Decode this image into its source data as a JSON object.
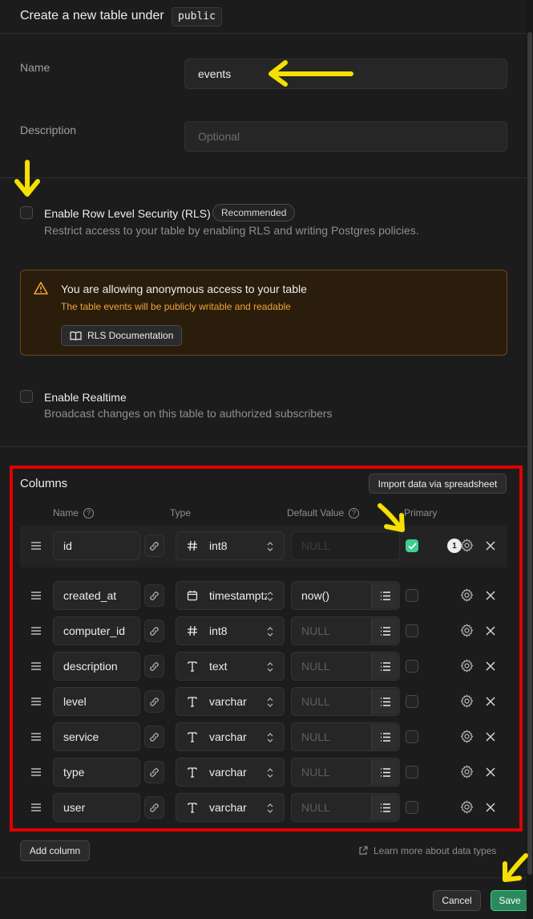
{
  "header": {
    "title": "Create a new table under",
    "schema": "public"
  },
  "form": {
    "name_label": "Name",
    "name_value": "events",
    "description_label": "Description",
    "description_placeholder": "Optional"
  },
  "rls": {
    "title": "Enable Row Level Security (RLS)",
    "badge": "Recommended",
    "subtitle": "Restrict access to your table by enabling RLS and writing Postgres policies.",
    "checked": false
  },
  "warning": {
    "title": "You are allowing anonymous access to your table",
    "subtitle": "The table events will be publicly writable and readable",
    "button": "RLS Documentation",
    "accent": "#f0a33a"
  },
  "realtime": {
    "title": "Enable Realtime",
    "subtitle": "Broadcast changes on this table to authorized subscribers",
    "checked": false
  },
  "columns": {
    "title": "Columns",
    "import_button": "Import data via spreadsheet",
    "headers": {
      "name": "Name",
      "type": "Type",
      "default": "Default Value",
      "primary": "Primary"
    },
    "rows": [
      {
        "name": "id",
        "type": "int8",
        "type_icon": "hash-icon",
        "default": "NULL",
        "default_is_placeholder": true,
        "default_disabled": true,
        "primary": true,
        "badge": "1"
      },
      {
        "name": "created_at",
        "type": "timestamptz",
        "type_icon": "calendar-icon",
        "default": "now()",
        "default_is_placeholder": false,
        "primary": false
      },
      {
        "name": "computer_id",
        "type": "int8",
        "type_icon": "hash-icon",
        "default": "NULL",
        "default_is_placeholder": true,
        "primary": false
      },
      {
        "name": "description",
        "type": "text",
        "type_icon": "text-icon",
        "default": "NULL",
        "default_is_placeholder": true,
        "primary": false
      },
      {
        "name": "level",
        "type": "varchar",
        "type_icon": "text-icon",
        "default": "NULL",
        "default_is_placeholder": true,
        "primary": false
      },
      {
        "name": "service",
        "type": "varchar",
        "type_icon": "text-icon",
        "default": "NULL",
        "default_is_placeholder": true,
        "primary": false
      },
      {
        "name": "type",
        "type": "varchar",
        "type_icon": "text-icon",
        "default": "NULL",
        "default_is_placeholder": true,
        "primary": false
      },
      {
        "name": "user",
        "type": "varchar",
        "type_icon": "text-icon",
        "default": "NULL",
        "default_is_placeholder": true,
        "primary": false
      }
    ],
    "add_button": "Add column",
    "learn_more": "Learn more about data types"
  },
  "footer": {
    "cancel": "Cancel",
    "save": "Save"
  },
  "colors": {
    "accent": "#3ecf8e",
    "annotation_arrow": "#f5e000",
    "annotation_box": "#e00000"
  }
}
